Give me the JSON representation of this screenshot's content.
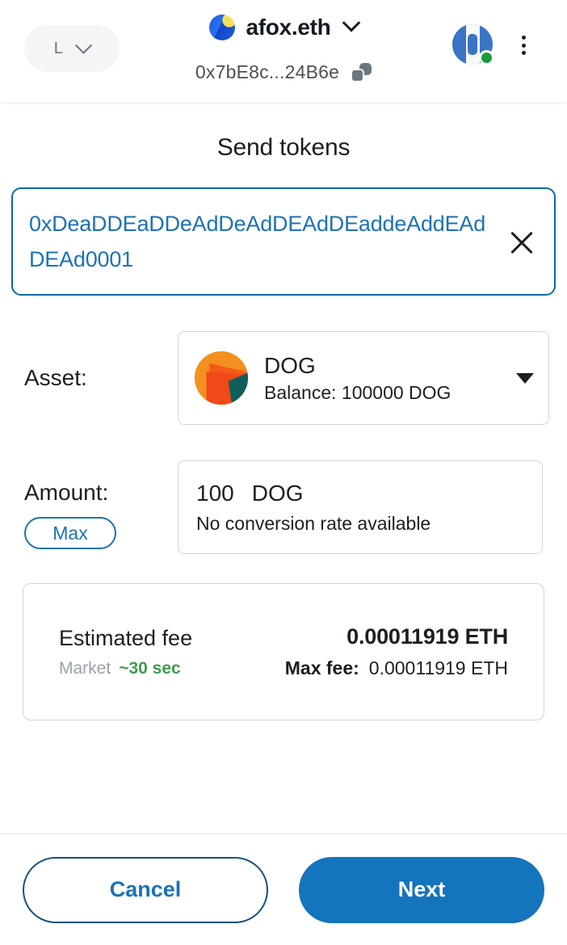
{
  "header": {
    "network_pill": {
      "label": "L",
      "icon": "chevron-down-icon"
    },
    "account": {
      "name": "afox.eth",
      "avatar": "account-avatar",
      "chevron": "chevron-down-icon"
    },
    "address": {
      "value": "0x7bE8c...24B6e",
      "copy_icon": "copy-icon"
    },
    "network_status": {
      "icon": "network-globe-icon",
      "status": "connected",
      "status_color": "#1a9c3c"
    },
    "menu": {
      "icon": "kebab-menu-icon"
    }
  },
  "main": {
    "title": "Send tokens",
    "recipient": {
      "value": "0xDeaDDEaDDeAdDeAdDEAdDEaddeAddEAdDEAd0001",
      "clear_icon": "close-icon"
    },
    "asset": {
      "label": "Asset:",
      "symbol": "DOG",
      "balance_label": "Balance:",
      "balance_value": "100000 DOG",
      "balance_full": "Balance:  100000 DOG",
      "token_icon": "dog-token-icon",
      "dropdown_icon": "caret-down-icon"
    },
    "amount": {
      "label": "Amount:",
      "max_label": "Max",
      "value": "100",
      "unit": "DOG",
      "note": "No conversion rate available"
    },
    "fee": {
      "title": "Estimated fee",
      "market_label": "Market",
      "time_estimate": "~30 sec",
      "amount": "0.00011919 ETH",
      "max_fee_label": "Max fee:",
      "max_fee_value": "0.00011919 ETH"
    }
  },
  "footer": {
    "cancel_label": "Cancel",
    "next_label": "Next"
  },
  "colors": {
    "accent_blue": "#1474bc",
    "link_blue": "#1b72b5",
    "focus_border": "#0d6aa8",
    "green": "#3f9a50",
    "status_green": "#1a9c3c",
    "gray_text": "#9aa1a8"
  }
}
